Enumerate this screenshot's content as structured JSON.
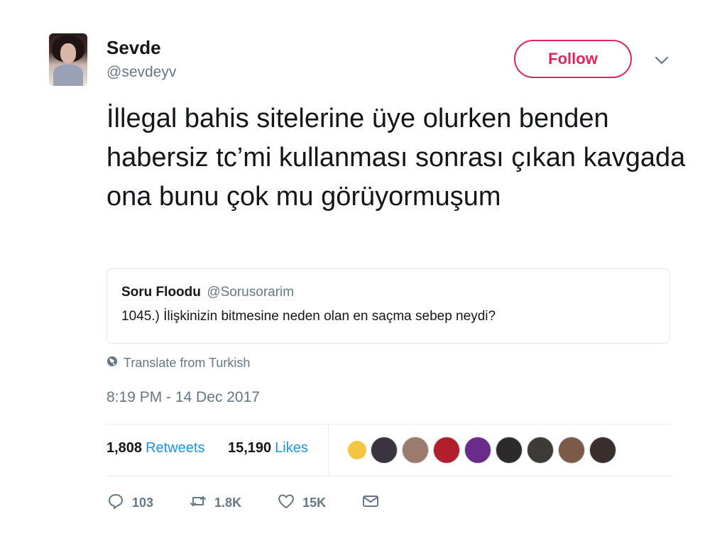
{
  "user": {
    "name": "Sevde",
    "handle": "@sevdeyv"
  },
  "follow_label": "Follow",
  "tweet_text": "İllegal bahis sitelerine üye olurken benden habersiz tc’mi kullanması sonrası çıkan kavgada ona bunu çok mu görüyormuşum",
  "quoted": {
    "name": "Soru Floodu",
    "handle": "@Sorusorarim",
    "text": "1045.) İlişkinizin bitmesine neden olan en saçma sebep neydi?"
  },
  "translate_label": "Translate from Turkish",
  "timestamp": "8:19 PM - 14 Dec 2017",
  "stats": {
    "retweets_count": "1,808",
    "retweets_label": "Retweets",
    "likes_count": "15,190",
    "likes_label": "Likes"
  },
  "likers_colors": [
    "#f4c542",
    "#3b3340",
    "#9d7a6e",
    "#b21e2b",
    "#6a2c8a",
    "#2d2b2a",
    "#3e3a36",
    "#7b5a48",
    "#3a2f2c"
  ],
  "actions": {
    "reply_count": "103",
    "retweet_count": "1.8K",
    "like_count": "15K"
  },
  "colors": {
    "accent": "#e0245e",
    "link": "#1b95e0",
    "muted": "#657786"
  },
  "icons": [
    "chevron-down-icon",
    "globe-icon",
    "reply-icon",
    "retweet-icon",
    "heart-icon",
    "mail-icon"
  ]
}
